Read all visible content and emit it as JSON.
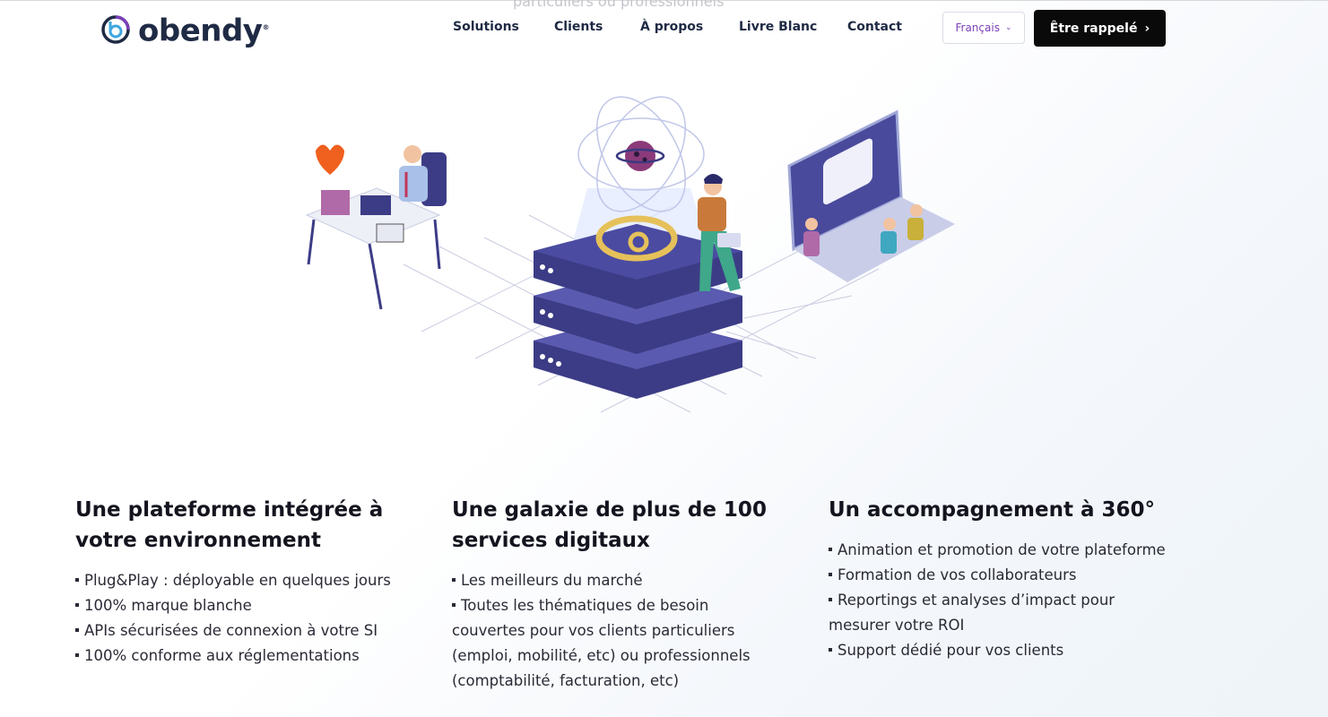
{
  "ghost_text": "particuliers ou professionnels",
  "header": {
    "logo_text": "obendy",
    "logo_reg": "®",
    "nav": [
      "Solutions",
      "Clients",
      "À propos",
      "Livre Blanc",
      "Contact"
    ],
    "language": "Français",
    "cta_label": "Être rappelé"
  },
  "columns": [
    {
      "title_line1": "Une plateforme intégrée à",
      "title_line2": "votre environnement",
      "items": [
        "Plug&Play : déployable en quelques jours",
        "100% marque blanche",
        "APIs sécurisées de connexion à votre SI",
        "100% conforme aux réglementations"
      ]
    },
    {
      "title_line1": "Une galaxie de plus de 100",
      "title_line2": "services digitaux",
      "items": [
        "Les meilleurs du marché",
        "Toutes les thématiques de besoin",
        "couvertes pour vos clients particuliers",
        "(emploi, mobilité, etc) ou professionnels",
        "(comptabilité, facturation, etc)"
      ]
    },
    {
      "title_line1": "Un accompagnement à 360°",
      "title_line2": "",
      "items": [
        "Animation et promotion de votre plateforme",
        "Formation de vos collaborateurs",
        "Reportings et analyses d’impact pour",
        "mesurer votre ROI",
        "Support dédié pour vos clients"
      ]
    }
  ],
  "colors": {
    "brand_dark": "#1f2a44",
    "accent_purple": "#7b3fb8",
    "server_blue": "#4a4a9c",
    "logo_gold": "#e6c15a"
  }
}
